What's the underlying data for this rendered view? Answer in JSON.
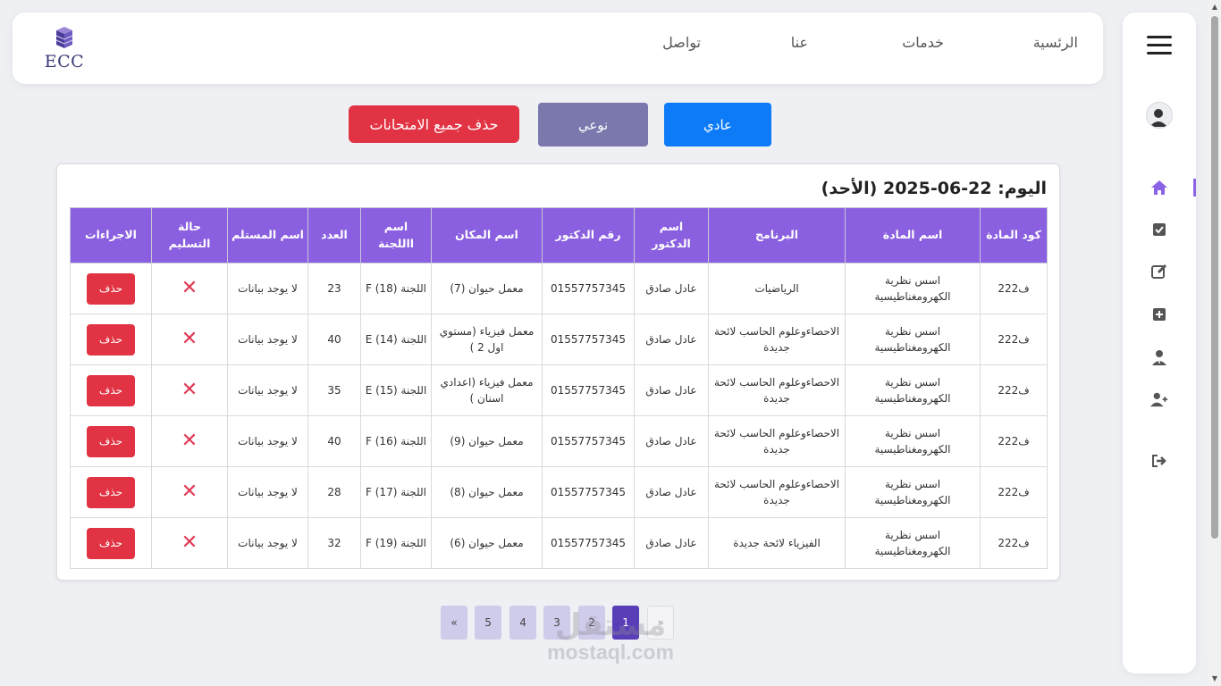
{
  "nav": {
    "links": [
      "الرئسية",
      "خدمات",
      "عنا",
      "تواصل"
    ],
    "logo_text": "ECC"
  },
  "sidebar": {
    "icons": [
      "home-icon",
      "check-square-icon",
      "edit-icon",
      "plus-square-icon",
      "user-tie-icon",
      "user-plus-icon",
      "logout-icon"
    ],
    "accent": "#8a63e6"
  },
  "actions": {
    "normal_label": "عادي",
    "type_label": "نوعي",
    "delete_all_label": "حذف جميع الامتحانات"
  },
  "card": {
    "date_title": "اليوم: 22-06-2025 (الأحد)"
  },
  "table": {
    "headers": [
      "كود المادة",
      "اسم المادة",
      "البرنامج",
      "اسم الدكتور",
      "رقم الدكتور",
      "اسم المكان",
      "اسم االلجنة",
      "العدد",
      "اسم المستلم",
      "حالة التسليم",
      "الاجراءات"
    ],
    "rows": [
      {
        "code": "ف222",
        "subject": "اسس نظرية الكهرومغناطيسية",
        "program": "الرياضيات",
        "doctor": "عادل صادق",
        "phone": "01557757345",
        "place": "معمل حيوان (7)",
        "committee": "اللجنة F (18)",
        "count": "23",
        "receiver": "لا يوجد بيانات",
        "delete": "حذف"
      },
      {
        "code": "ف222",
        "subject": "اسس نظرية الكهرومغناطيسية",
        "program": "الاحصاءوعلوم الحاسب لائحة جديدة",
        "doctor": "عادل صادق",
        "phone": "01557757345",
        "place": "معمل فيزياء (مستوي اول 2 )",
        "committee": "اللجنة E (14)",
        "count": "40",
        "receiver": "لا يوجد بيانات",
        "delete": "حذف"
      },
      {
        "code": "ف222",
        "subject": "اسس نظرية الكهرومغناطيسية",
        "program": "الاحصاءوعلوم الحاسب لائحة جديدة",
        "doctor": "عادل صادق",
        "phone": "01557757345",
        "place": "معمل فيزياء (اعدادي اسنان )",
        "committee": "اللجنة E (15)",
        "count": "35",
        "receiver": "لا يوجد بيانات",
        "delete": "حذف"
      },
      {
        "code": "ف222",
        "subject": "اسس نظرية الكهرومغناطيسية",
        "program": "الاحصاءوعلوم الحاسب لائحة جديدة",
        "doctor": "عادل صادق",
        "phone": "01557757345",
        "place": "معمل حيوان (9)",
        "committee": "اللجنة F (16)",
        "count": "40",
        "receiver": "لا يوجد بيانات",
        "delete": "حذف"
      },
      {
        "code": "ف222",
        "subject": "اسس نظرية الكهرومغناطيسية",
        "program": "الاحصاءوعلوم الحاسب لائحة جديدة",
        "doctor": "عادل صادق",
        "phone": "01557757345",
        "place": "معمل حيوان (8)",
        "committee": "اللجنة F (17)",
        "count": "28",
        "receiver": "لا يوجد بيانات",
        "delete": "حذف"
      },
      {
        "code": "ف222",
        "subject": "اسس نظرية الكهرومغناطيسية",
        "program": "الفيزياء لائحة جديدة",
        "doctor": "عادل صادق",
        "phone": "01557757345",
        "place": "معمل حيوان (6)",
        "committee": "اللجنة F (19)",
        "count": "32",
        "receiver": "لا يوجد بيانات",
        "delete": "حذف"
      }
    ]
  },
  "pagination": {
    "prev": "«",
    "pages": [
      "1",
      "2",
      "3",
      "4",
      "5"
    ],
    "active": "1",
    "next": "»"
  },
  "watermark": {
    "arabic": "مستقل",
    "latin": "mostaql.com"
  }
}
